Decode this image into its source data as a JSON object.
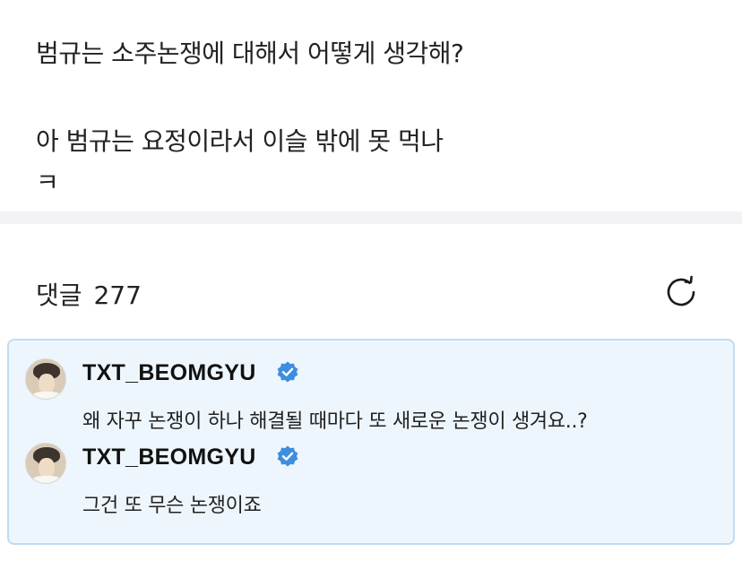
{
  "post": {
    "line1": "범규는 소주논쟁에 대해서 어떻게 생각해?",
    "line2": "아 범규는 요정이라서 이슬 밖에 못 먹나",
    "line3": "ㅋ"
  },
  "comments_header": {
    "label": "댓글",
    "count": "277",
    "refresh_icon": "refresh-icon"
  },
  "artist_comments": [
    {
      "username": "TXT_BEOMGYU",
      "verified": true,
      "text": "왜 자꾸 논쟁이 하나 해결될 때마다 또 새로운 논쟁이 생겨요..?"
    },
    {
      "username": "TXT_BEOMGYU",
      "verified": true,
      "text": "그건 또 무슨 논쟁이죠"
    }
  ],
  "colors": {
    "artist_box_bg": "#eef6fd",
    "artist_box_border": "#bfdcf3",
    "verified_badge": "#3e8ee0"
  }
}
